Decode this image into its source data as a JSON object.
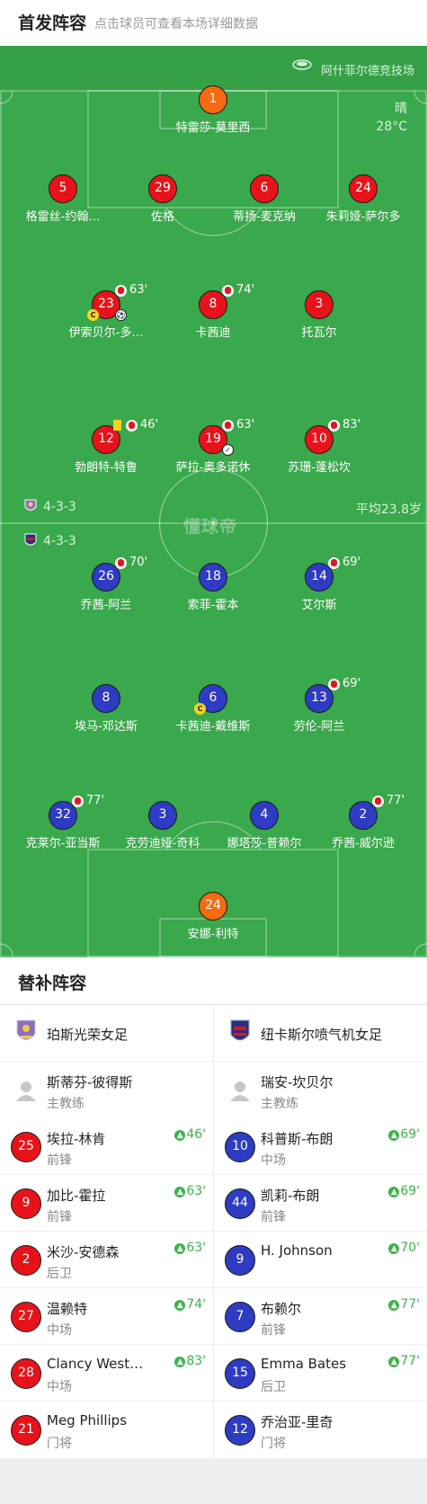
{
  "header": {
    "title": "首发阵容",
    "subtitle": "点击球员可查看本场详细数据"
  },
  "pitch": {
    "venue": "阿什菲尔德竞技场",
    "weather": "晴",
    "temperature": "28°C",
    "watermark": "懂球帝",
    "home_formation": "4-3-3",
    "away_formation": "4-3-3",
    "average_age": "平均23.8岁",
    "colors": {
      "home": "#e8131a",
      "away": "#2e3bc3",
      "goalkeeper": "#f66a11",
      "pitch": "#3aa84c"
    }
  },
  "home_players": [
    {
      "number": "1",
      "name": "特雷莎-莫里西"
    },
    {
      "number": "5",
      "name": "格雷丝-约翰…"
    },
    {
      "number": "29",
      "name": "佐格"
    },
    {
      "number": "6",
      "name": "蒂扬-麦克纳"
    },
    {
      "number": "24",
      "name": "朱莉娅-萨尔多"
    },
    {
      "number": "23",
      "name": "伊索贝尔-多…",
      "sub_minute": "63'",
      "captain": "C",
      "goal": "⚽"
    },
    {
      "number": "8",
      "name": "卡茜迪",
      "sub_minute": "74'"
    },
    {
      "number": "3",
      "name": "托瓦尔"
    },
    {
      "number": "12",
      "name": "勃朗特-特鲁",
      "sub_minute": "46'",
      "yellow_card": true
    },
    {
      "number": "19",
      "name": "萨拉-奥多诺休",
      "sub_minute": "63'",
      "assist": "✓"
    },
    {
      "number": "10",
      "name": "苏珊-蓬松坎",
      "sub_minute": "83'"
    }
  ],
  "away_players": [
    {
      "number": "26",
      "name": "乔茜-阿兰",
      "sub_minute": "70'"
    },
    {
      "number": "18",
      "name": "索菲-霍本"
    },
    {
      "number": "14",
      "name": "艾尔斯",
      "sub_minute": "69'"
    },
    {
      "number": "8",
      "name": "埃马-邓达斯"
    },
    {
      "number": "6",
      "name": "卡茜迪-戴维斯",
      "captain": "C"
    },
    {
      "number": "13",
      "name": "劳伦-阿兰",
      "sub_minute": "69'"
    },
    {
      "number": "32",
      "name": "克莱尔-亚当斯",
      "sub_minute": "77'"
    },
    {
      "number": "3",
      "name": "克劳迪娅-奇科"
    },
    {
      "number": "4",
      "name": "娜塔莎-普赖尔"
    },
    {
      "number": "2",
      "name": "乔茜-威尔逊",
      "sub_minute": "77'"
    },
    {
      "number": "24",
      "name": "安娜-利特"
    }
  ],
  "subs": {
    "title": "替补阵容",
    "home": {
      "team": "珀斯光荣女足",
      "coach": {
        "name": "斯蒂芬-彼得斯",
        "role": "主教练"
      },
      "players": [
        {
          "number": "25",
          "name": "埃拉-林肯",
          "position": "前锋",
          "on": "46'"
        },
        {
          "number": "9",
          "name": "加比-霍拉",
          "position": "前锋",
          "on": "63'"
        },
        {
          "number": "2",
          "name": "米沙-安德森",
          "position": "后卫",
          "on": "63'"
        },
        {
          "number": "27",
          "name": "温赖特",
          "position": "中场",
          "on": "74'"
        },
        {
          "number": "28",
          "name": "Clancy West…",
          "position": "中场",
          "on": "83'"
        },
        {
          "number": "21",
          "name": "Meg Phillips",
          "position": "门将"
        }
      ]
    },
    "away": {
      "team": "纽卡斯尔喷气机女足",
      "coach": {
        "name": "瑞安-坎贝尔",
        "role": "主教练"
      },
      "players": [
        {
          "number": "10",
          "name": "科普斯-布朗",
          "position": "中场",
          "on": "69'"
        },
        {
          "number": "44",
          "name": "凯莉-布朗",
          "position": "前锋",
          "on": "69'"
        },
        {
          "number": "9",
          "name": "H. Johnson",
          "position": "",
          "on": "70'"
        },
        {
          "number": "7",
          "name": "布赖尔",
          "position": "前锋",
          "on": "77'"
        },
        {
          "number": "15",
          "name": "Emma Bates",
          "position": "后卫",
          "on": "77'"
        },
        {
          "number": "12",
          "name": "乔治亚-里奇",
          "position": "门将"
        }
      ]
    }
  }
}
